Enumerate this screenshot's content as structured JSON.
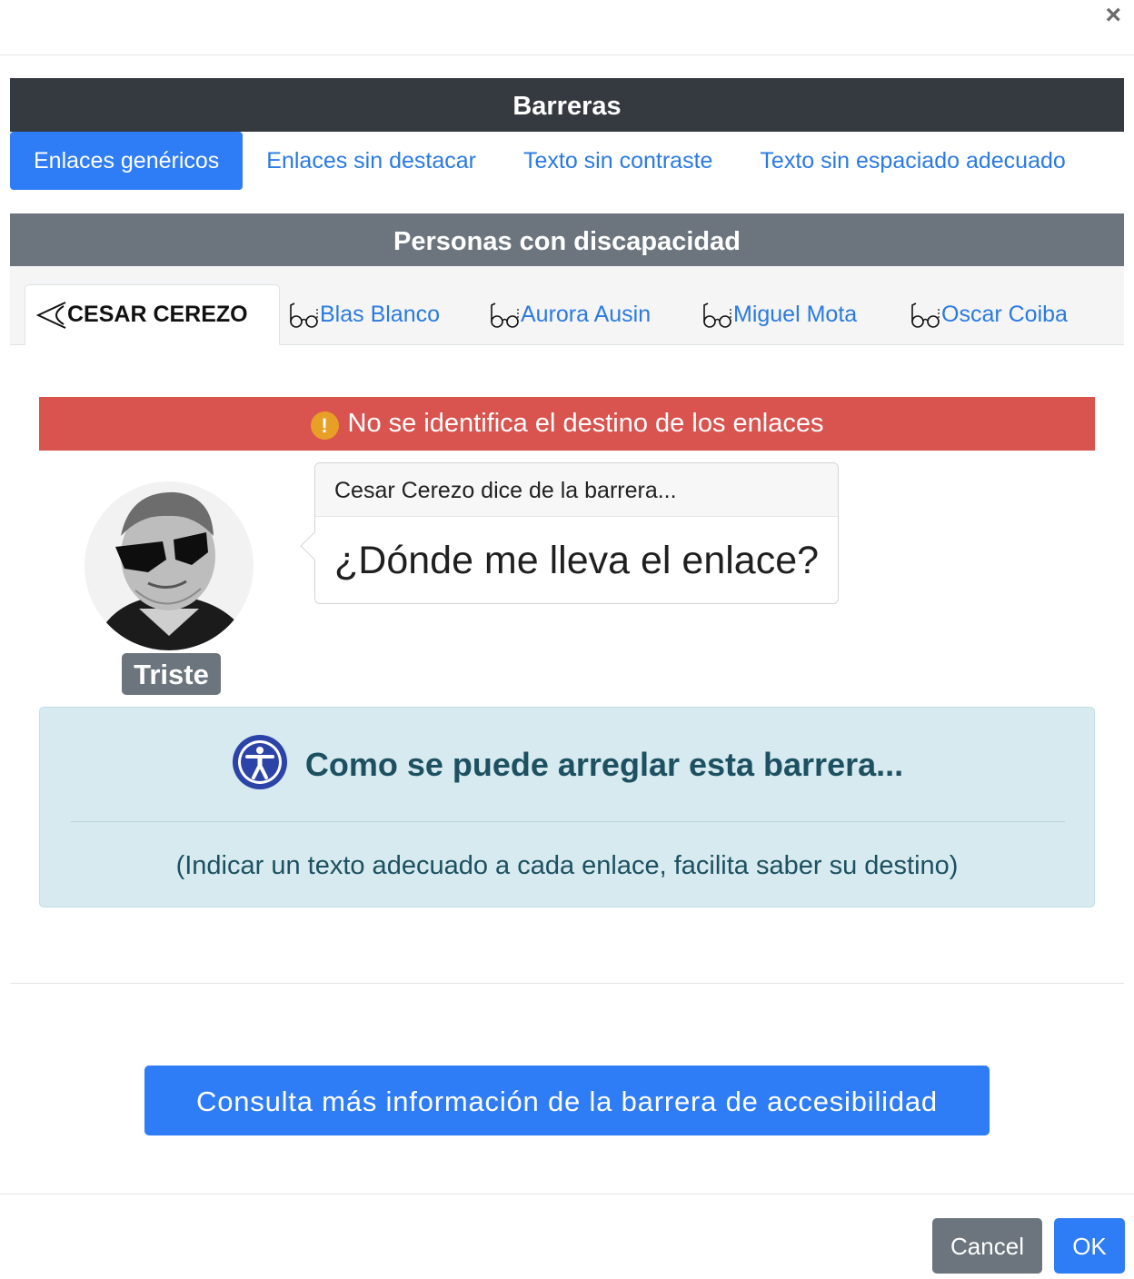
{
  "dialog": {
    "close_label": "×"
  },
  "barreras": {
    "title": "Barreras",
    "tabs": [
      {
        "label": "Enlaces genéricos",
        "active": true
      },
      {
        "label": "Enlaces sin destacar",
        "active": false
      },
      {
        "label": "Texto sin contraste",
        "active": false
      },
      {
        "label": "Texto sin espaciado adecuado",
        "active": false
      }
    ]
  },
  "personas": {
    "title": "Personas con discapacidad",
    "tabs": [
      {
        "label": "CESAR CEREZO",
        "icon": "eye-icon",
        "active": true
      },
      {
        "label": "Blas Blanco",
        "icon": "glasses-icon",
        "active": false
      },
      {
        "label": "Aurora Ausin",
        "icon": "glasses-icon",
        "active": false
      },
      {
        "label": "Miguel Mota",
        "icon": "glasses-icon",
        "active": false
      },
      {
        "label": "Oscar Coiba",
        "icon": "glasses-icon",
        "active": false
      }
    ]
  },
  "alert": {
    "icon_glyph": "!",
    "text": "No se identifica el destino de los enlaces"
  },
  "persona_card": {
    "mood": "Triste",
    "quote_header": "Cesar Cerezo dice de la barrera...",
    "quote": "¿Dónde me lleva el enlace?"
  },
  "fix": {
    "title": "Como se puede arreglar esta barrera...",
    "description": "(Indicar un texto adecuado a cada enlace, facilita saber su destino)"
  },
  "more_info_button": "Consulta más información de la barrera de accesibilidad",
  "footer": {
    "cancel": "Cancel",
    "ok": "OK"
  },
  "colors": {
    "primary": "#2e7cf6",
    "dark_header": "#343a40",
    "secondary": "#6c757d",
    "danger": "#d9534f",
    "info_bg": "#d6eaef",
    "link": "#2a7ae2"
  }
}
